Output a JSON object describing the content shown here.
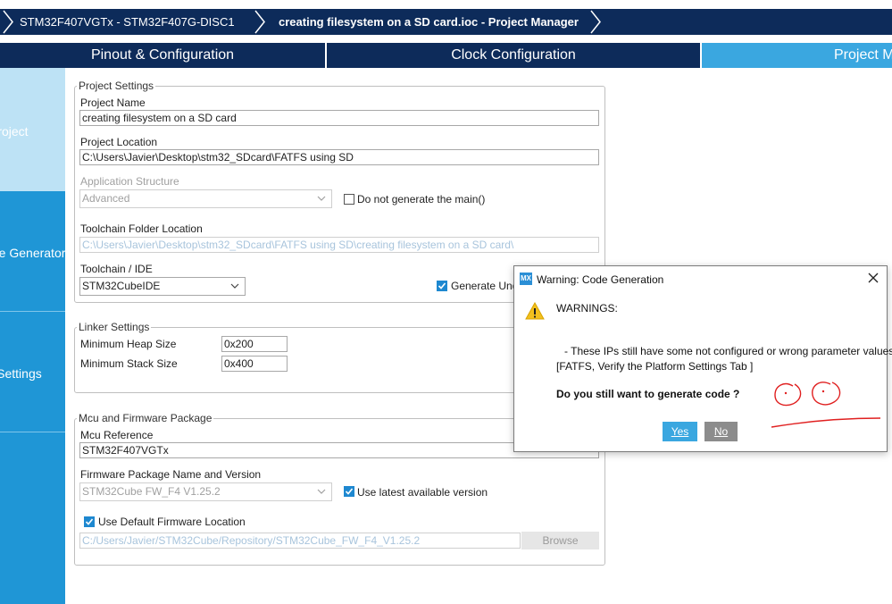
{
  "breadcrumbs": [
    "STM32F407VGTx  -  STM32F407G-DISC1",
    "creating filesystem on a SD card.ioc - Project Manager"
  ],
  "tabs": [
    "Pinout & Configuration",
    "Clock Configuration",
    "Project Manager"
  ],
  "sidebar": [
    "Project",
    "Code Generator",
    "Advanced Settings"
  ],
  "project_settings": {
    "legend": "Project Settings",
    "name_label": "Project Name",
    "name_value": "creating filesystem on a SD card",
    "location_label": "Project Location",
    "location_value": "C:\\Users\\Javier\\Desktop\\stm32_SDcard\\FATFS using SD",
    "app_structure_label": "Application Structure",
    "app_structure_value": "Advanced",
    "no_main_label": "Do not generate the main()",
    "toolchain_folder_label": "Toolchain Folder Location",
    "toolchain_folder_value": "C:\\Users\\Javier\\Desktop\\stm32_SDcard\\FATFS using SD\\creating filesystem on a SD card\\",
    "toolchain_label": "Toolchain / IDE",
    "toolchain_value": "STM32CubeIDE",
    "generate_under_root_label": "Generate Under Root"
  },
  "linker_settings": {
    "legend": "Linker Settings",
    "heap_label": "Minimum Heap Size",
    "heap_value": "0x200",
    "stack_label": "Minimum Stack Size",
    "stack_value": "0x400"
  },
  "mcu_firmware": {
    "legend": "Mcu and Firmware Package",
    "mcu_ref_label": "Mcu Reference",
    "mcu_ref_value": "STM32F407VGTx",
    "fw_label": "Firmware Package Name and Version",
    "fw_value": "STM32Cube FW_F4 V1.25.2",
    "latest_label": "Use latest available version",
    "default_loc_label": "Use Default Firmware Location",
    "fw_path_value": "C:/Users/Javier/STM32Cube/Repository/STM32Cube_FW_F4_V1.25.2",
    "browse_label": "Browse"
  },
  "dialog": {
    "icon_text": "MX",
    "title": "Warning: Code Generation",
    "heading": "WARNINGS:",
    "line1": "- These IPs still have some not configured or wrong parameter values:",
    "line2": "[FATFS, Verify the Platform Settings Tab ]",
    "question": "Do you still want to generate code ?",
    "yes_label": "Yes",
    "no_label": "No"
  },
  "colors": {
    "navy": "#0d2b5a",
    "accent": "#3aa7e0",
    "sidebar": "#1f96d6",
    "scribble": "#e02020"
  }
}
